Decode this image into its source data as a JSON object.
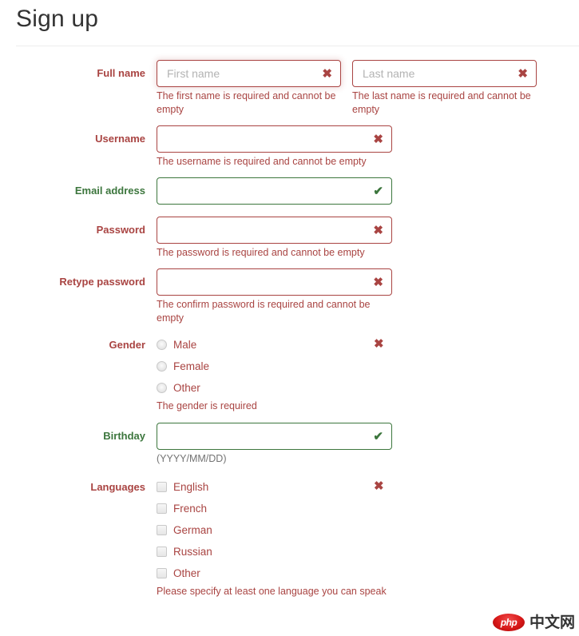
{
  "header": {
    "title": "Sign up"
  },
  "form": {
    "rows": [
      {
        "label": "Full name",
        "label_state": "error",
        "fields": [
          {
            "placeholder": "First name",
            "value": "",
            "state": "error",
            "icon": "cross-icon",
            "focused": true,
            "help": "The first name is required and cannot be empty"
          },
          {
            "placeholder": "Last name",
            "value": "",
            "state": "error",
            "icon": "cross-icon",
            "focused": false,
            "help": "The last name is required and cannot be empty"
          }
        ]
      },
      {
        "label": "Username",
        "label_state": "error",
        "placeholder": "",
        "value": "",
        "state": "error",
        "icon": "cross-icon",
        "help": "The username is required and cannot be empty"
      },
      {
        "label": "Email address",
        "label_state": "ok",
        "placeholder": "",
        "value": "",
        "state": "ok",
        "icon": "check-icon",
        "help": ""
      },
      {
        "label": "Password",
        "label_state": "error",
        "placeholder": "",
        "value": "",
        "state": "error",
        "icon": "cross-icon",
        "help": "The password is required and cannot be empty"
      },
      {
        "label": "Retype password",
        "label_state": "error",
        "placeholder": "",
        "value": "",
        "state": "error",
        "icon": "cross-icon",
        "help": "The confirm password is required and cannot be empty"
      },
      {
        "label": "Gender",
        "label_state": "error",
        "state": "error",
        "icon": "cross-icon",
        "options": [
          "Male",
          "Female",
          "Other"
        ],
        "help": "The gender is required"
      },
      {
        "label": "Birthday",
        "label_state": "ok",
        "placeholder": "",
        "value": "",
        "state": "ok",
        "icon": "check-icon",
        "help": "(YYYY/MM/DD)",
        "help_muted": true
      },
      {
        "label": "Languages",
        "label_state": "error",
        "state": "error",
        "icon": "cross-icon",
        "options": [
          "English",
          "French",
          "German",
          "Russian",
          "Other"
        ],
        "help": "Please specify at least one language you can speak"
      }
    ]
  },
  "glyphs": {
    "cross": "✖",
    "check": "✔"
  },
  "watermark": {
    "badge": "php",
    "text": "中文网"
  },
  "colors": {
    "error": "#a94442",
    "success": "#3c763d",
    "muted": "#737373",
    "title": "#333333",
    "brand_red": "#d61616"
  }
}
